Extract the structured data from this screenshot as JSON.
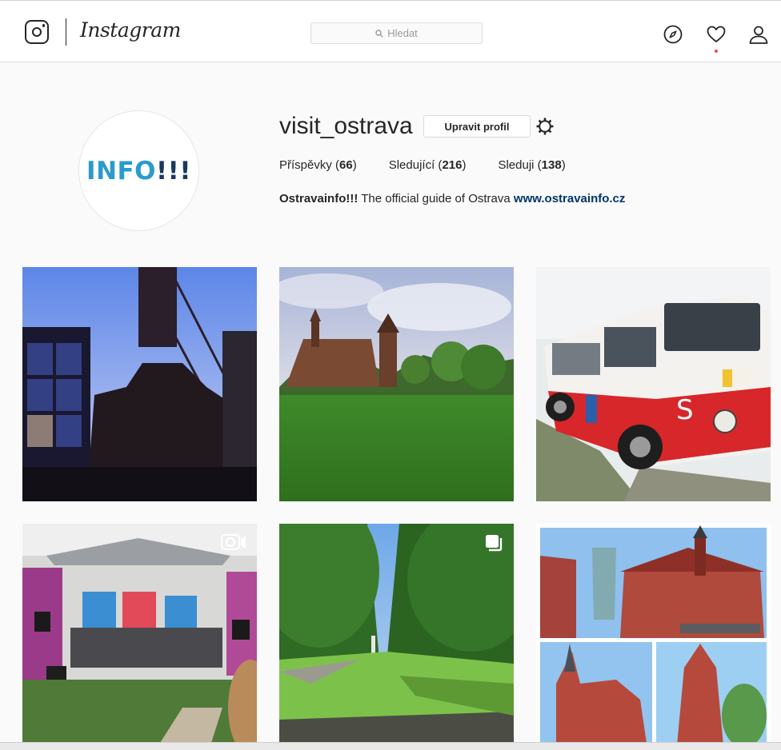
{
  "header": {
    "logo_text": "Instagram",
    "search_placeholder": "Hledat",
    "icons": [
      "instagram-camera-icon",
      "search-icon",
      "explore-compass-icon",
      "activity-heart-icon",
      "profile-person-icon"
    ],
    "notification_dot_color": "#ed4956"
  },
  "profile": {
    "avatar_text_info": "INFO",
    "avatar_text_bang": "!!!",
    "username": "visit_ostrava",
    "edit_button": "Upravit profil",
    "stats": [
      {
        "label": "Příspěvky",
        "value": "66"
      },
      {
        "label": "Sledující",
        "value": "216"
      },
      {
        "label": "Sleduji",
        "value": "138"
      }
    ],
    "bio_name": "Ostravainfo!!!",
    "bio_text": "The official guide of Ostrava",
    "bio_link": "www.ostravainfo.cz"
  },
  "posts": [
    {
      "subject": "mine-tower-silhouette"
    },
    {
      "subject": "wooden-church-park"
    },
    {
      "subject": "red-white-bus"
    },
    {
      "subject": "outdoor-stage-concert",
      "badge": "video-icon"
    },
    {
      "subject": "tree-lined-avenue",
      "badge": "carousel-icon"
    },
    {
      "subject": "red-brick-buildings-collage"
    }
  ],
  "colors": {
    "link": "#003569",
    "avatar_blue": "#2b9bcb",
    "avatar_navy": "#163a5c",
    "border": "#dbdbdb"
  }
}
